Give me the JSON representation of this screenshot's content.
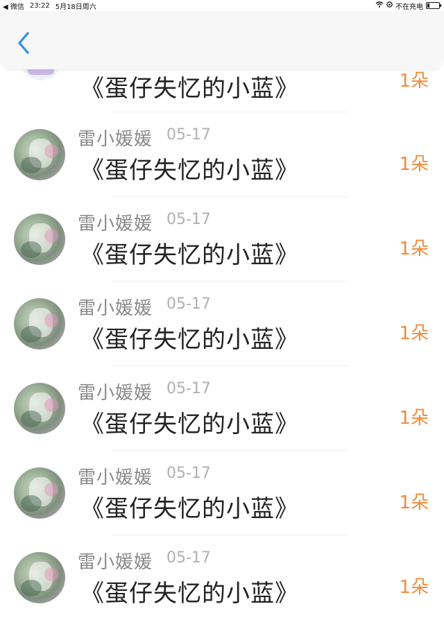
{
  "status_bar": {
    "back_app": "◀ 微信",
    "time": "23:22",
    "date": "5月18日周六",
    "charging_status": "不在充电"
  },
  "nav": {
    "back_icon": "chevron-left-icon",
    "accent_color": "#2f8df2"
  },
  "list": {
    "first_title": "《蛋仔失忆的小蓝》",
    "first_count": "1朵",
    "items": [
      {
        "user": "雷小媛媛",
        "date": "05-17",
        "title": "《蛋仔失忆的小蓝》",
        "count": "1朵"
      },
      {
        "user": "雷小媛媛",
        "date": "05-17",
        "title": "《蛋仔失忆的小蓝》",
        "count": "1朵"
      },
      {
        "user": "雷小媛媛",
        "date": "05-17",
        "title": "《蛋仔失忆的小蓝》",
        "count": "1朵"
      },
      {
        "user": "雷小媛媛",
        "date": "05-17",
        "title": "《蛋仔失忆的小蓝》",
        "count": "1朵"
      },
      {
        "user": "雷小媛媛",
        "date": "05-17",
        "title": "《蛋仔失忆的小蓝》",
        "count": "1朵"
      },
      {
        "user": "雷小媛媛",
        "date": "05-17",
        "title": "《蛋仔失忆的小蓝》",
        "count": "1朵"
      }
    ]
  },
  "colors": {
    "count_color": "#f08b3a",
    "username_color": "#8a8a8a",
    "date_color": "#b0b0b0"
  }
}
